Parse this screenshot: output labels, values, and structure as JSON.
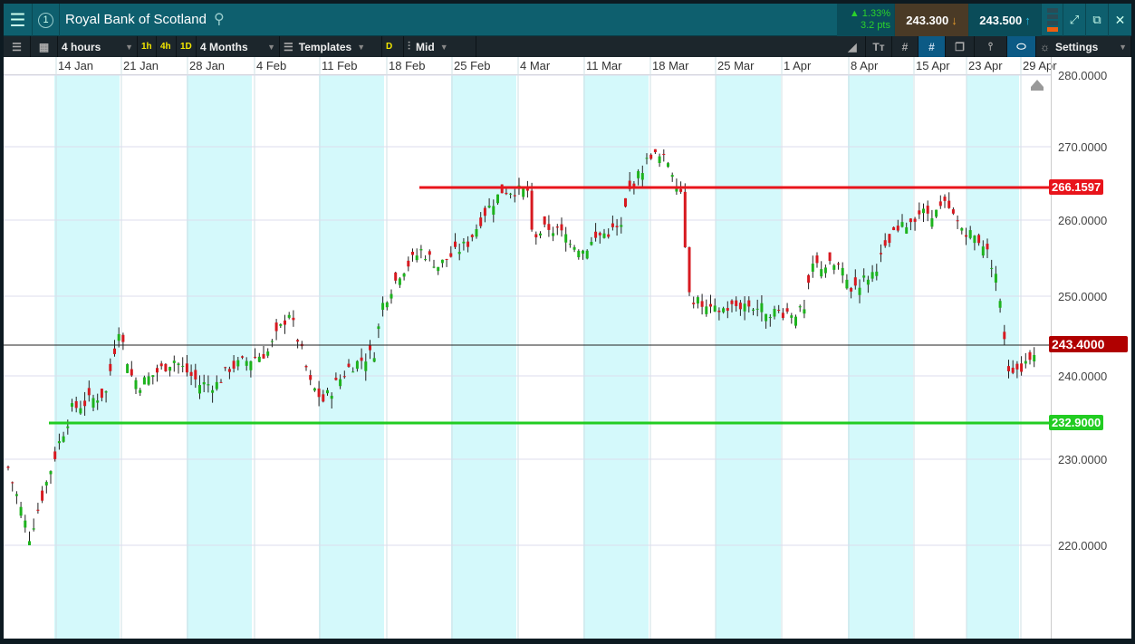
{
  "header": {
    "title": "Royal Bank of Scotland",
    "change_pct": "▲ 1.33%",
    "change_pts": "3.2 pts",
    "sell": "243.300",
    "buy": "243.500",
    "badge": "1"
  },
  "toolbar": {
    "interval": "4 hours",
    "q1": "1h",
    "q2": "4h",
    "q3": "1D",
    "range": "4 Months",
    "templates": "Templates",
    "d": "D",
    "price_type": "Mid",
    "settings": "Settings"
  },
  "colors": {
    "up": "#1db31d",
    "down": "#d71920",
    "resistance": "#e8141b",
    "support": "#22cc22",
    "current": "#b00000"
  },
  "chart_data": {
    "type": "candlestick",
    "x_tick_labels": [
      "14 Jan",
      "21 Jan",
      "28 Jan",
      "4 Feb",
      "11 Feb",
      "18 Feb",
      "25 Feb",
      "4 Mar",
      "11 Mar",
      "18 Mar",
      "25 Mar",
      "1 Apr",
      "8 Apr",
      "15 Apr",
      "23 Apr",
      "29 Apr"
    ],
    "y_tick_labels": [
      "280.0000",
      "270.0000",
      "260.0000",
      "250.0000",
      "240.0000",
      "230.0000",
      "220.0000"
    ],
    "y_ticks": [
      280,
      270,
      260,
      250,
      240,
      230,
      220
    ],
    "approx_close_path": [
      [
        0,
        229
      ],
      [
        5,
        221
      ],
      [
        12,
        232
      ],
      [
        15,
        236
      ],
      [
        23,
        238
      ],
      [
        26,
        246
      ],
      [
        29,
        240
      ],
      [
        31,
        239
      ],
      [
        39,
        242
      ],
      [
        45,
        239
      ],
      [
        49,
        239
      ],
      [
        52,
        241
      ],
      [
        61,
        243
      ],
      [
        66,
        248
      ],
      [
        69,
        243
      ],
      [
        71,
        239
      ],
      [
        74,
        237
      ],
      [
        80,
        241
      ],
      [
        86,
        243
      ],
      [
        88,
        249
      ],
      [
        92,
        253
      ],
      [
        97,
        256
      ],
      [
        101,
        254
      ],
      [
        108,
        257
      ],
      [
        112,
        261
      ],
      [
        116,
        264
      ],
      [
        122,
        264
      ],
      [
        123,
        258
      ],
      [
        127,
        259
      ],
      [
        131,
        258
      ],
      [
        135,
        256
      ],
      [
        139,
        258
      ],
      [
        144,
        259
      ],
      [
        146,
        264
      ],
      [
        151,
        269
      ],
      [
        155,
        268
      ],
      [
        158,
        264
      ],
      [
        160,
        250
      ],
      [
        165,
        248
      ],
      [
        173,
        249
      ],
      [
        180,
        248
      ],
      [
        187,
        248
      ],
      [
        189,
        254
      ],
      [
        195,
        254
      ],
      [
        198,
        251
      ],
      [
        203,
        253
      ],
      [
        208,
        258
      ],
      [
        214,
        261
      ],
      [
        218,
        261
      ],
      [
        220,
        262
      ],
      [
        224,
        259
      ],
      [
        229,
        257
      ],
      [
        232,
        253
      ],
      [
        233,
        249
      ],
      [
        235,
        241
      ],
      [
        238,
        241
      ],
      [
        241,
        243.4
      ]
    ],
    "resistance": {
      "label": "266.1597"
    },
    "current": {
      "label": "243.4000"
    },
    "support": {
      "label": "232.9000"
    }
  }
}
